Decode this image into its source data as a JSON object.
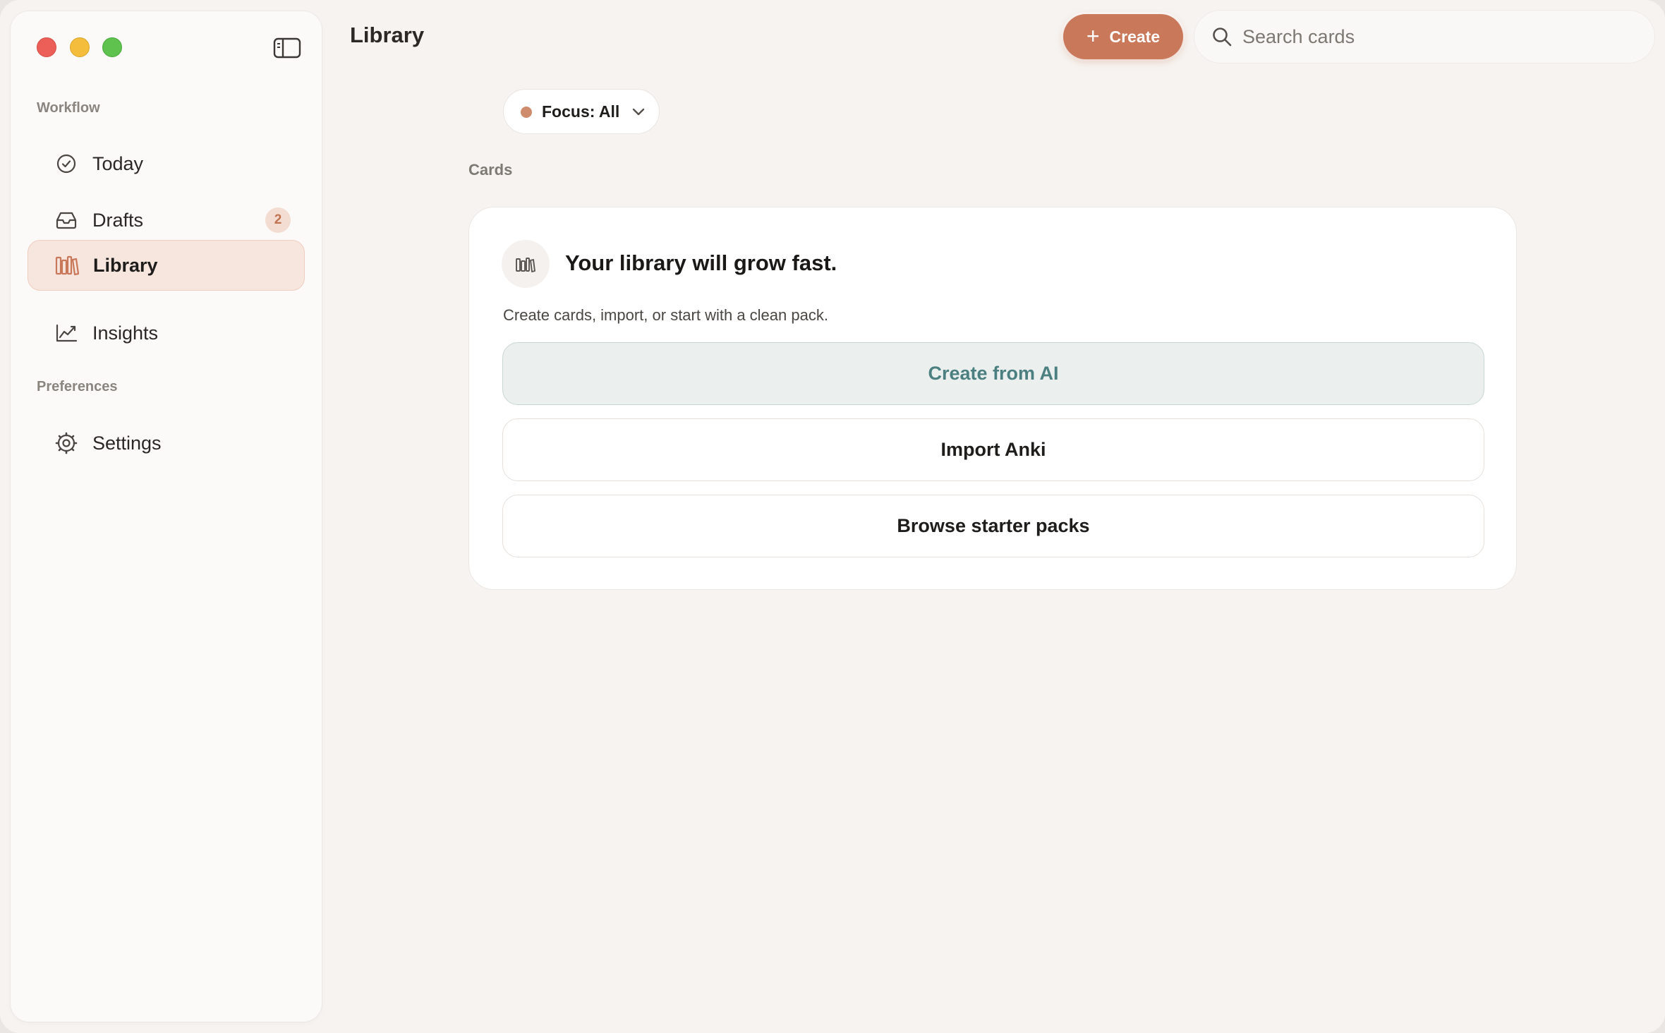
{
  "window": {
    "title": "Library"
  },
  "sidebar": {
    "sections": [
      {
        "label": "Workflow",
        "items": [
          {
            "label": "Today",
            "icon": "check-circle-icon"
          },
          {
            "label": "Drafts",
            "icon": "inbox-icon",
            "badge": "2"
          },
          {
            "label": "Library",
            "icon": "books-icon",
            "active": true
          },
          {
            "label": "Insights",
            "icon": "chart-line-icon"
          }
        ]
      },
      {
        "label": "Preferences",
        "items": [
          {
            "label": "Settings",
            "icon": "gear-icon"
          }
        ]
      }
    ]
  },
  "header": {
    "create_label": "Create",
    "search_placeholder": "Search cards"
  },
  "filter": {
    "focus_label": "Focus: All",
    "dot_color": "#cf8c6c"
  },
  "main": {
    "section_label": "Cards",
    "empty_state": {
      "title": "Your library will grow fast.",
      "subtitle": "Create cards, import, or start with a clean pack.",
      "actions": [
        {
          "label": "Create from AI",
          "primary": true
        },
        {
          "label": "Import Anki"
        },
        {
          "label": "Browse starter packs"
        }
      ]
    }
  },
  "colors": {
    "accent": "#c9785a",
    "active_nav_bg": "#f6e6de",
    "primary_action_text": "#4c7f80"
  }
}
